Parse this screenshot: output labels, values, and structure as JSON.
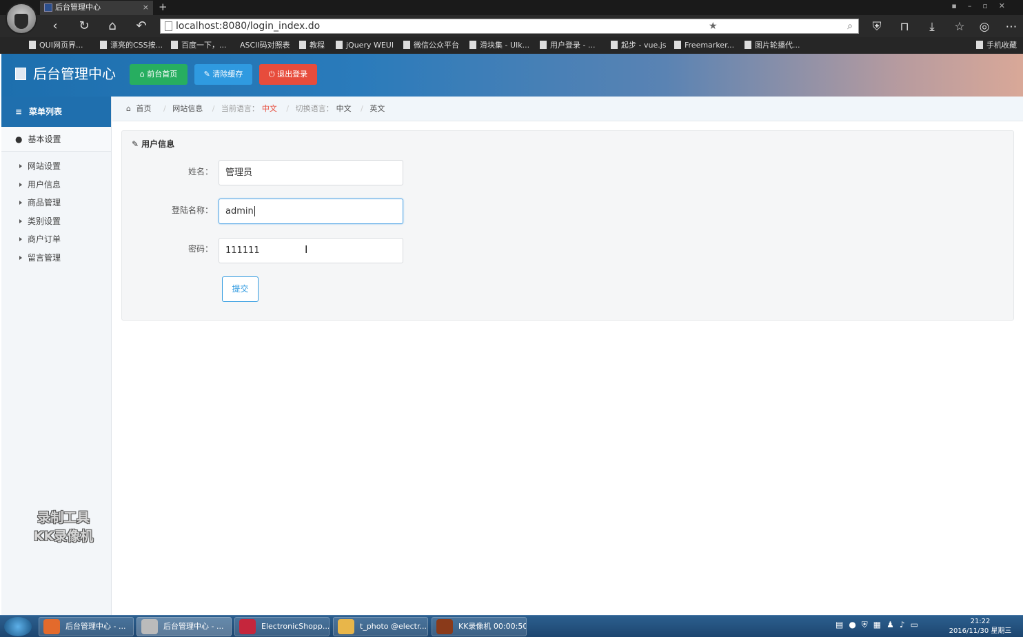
{
  "browser": {
    "tab_title": "后台管理中心",
    "tab_close": "×",
    "new_tab": "+",
    "url": "localhost:8080/login_index.do",
    "bookmarks": [
      "QUI网页界...",
      "漂亮的CSS按...",
      "百度一下，...",
      "ASCII码对照表",
      "教程",
      "jQuery WEUI",
      "微信公众平台",
      "滑块集 - UIk...",
      "用户登录 - ...",
      "起步 - vue.js",
      "Freemarker...",
      "图片轮播代...",
      "手机收藏"
    ]
  },
  "header": {
    "title": "后台管理中心",
    "buttons": {
      "home": "前台首页",
      "clear_cache": "清除缓存",
      "logout": "退出登录"
    }
  },
  "sidebar": {
    "menu_title": "菜单列表",
    "group_title": "基本设置",
    "items": [
      "网站设置",
      "用户信息",
      "商品管理",
      "类别设置",
      "商户订单",
      "留言管理"
    ],
    "watermark_line1": "录制工具",
    "watermark_line2": "KK录像机"
  },
  "breadcrumb": {
    "home": "首页",
    "site_info": "网站信息",
    "current_lang_label": "当前语言：",
    "current_lang_value": "中文",
    "switch_lang_label": "切换语言：",
    "lang_zh": "中文",
    "lang_en": "英文"
  },
  "panel": {
    "title": "用户信息",
    "fields": {
      "name_label": "姓名：",
      "name_value": "管理员",
      "login_label": "登陆名称：",
      "login_value": "admin",
      "password_label": "密码：",
      "password_value": "111111"
    },
    "submit": "提交"
  },
  "taskbar": {
    "items": [
      "后台管理中心 - ...",
      "后台管理中心 - ...",
      "ElectronicShopp...",
      "t_photo @electr...",
      "KK录像机 00:00:50"
    ],
    "clock_time": "21:22",
    "clock_date": "2016/11/30 星期三"
  },
  "colors": {
    "header_blue": "#1d6fae",
    "btn_green": "#27ae60",
    "btn_blue": "#2f9ae0",
    "btn_red": "#e74c3c",
    "accent_red_text": "#e74c3c"
  },
  "icons": {
    "back": "arrow-left-icon",
    "reload": "reload-icon",
    "home": "home-icon",
    "undo": "undo-icon",
    "menu": "list-icon",
    "user": "user-icon",
    "edit": "edit-icon"
  }
}
